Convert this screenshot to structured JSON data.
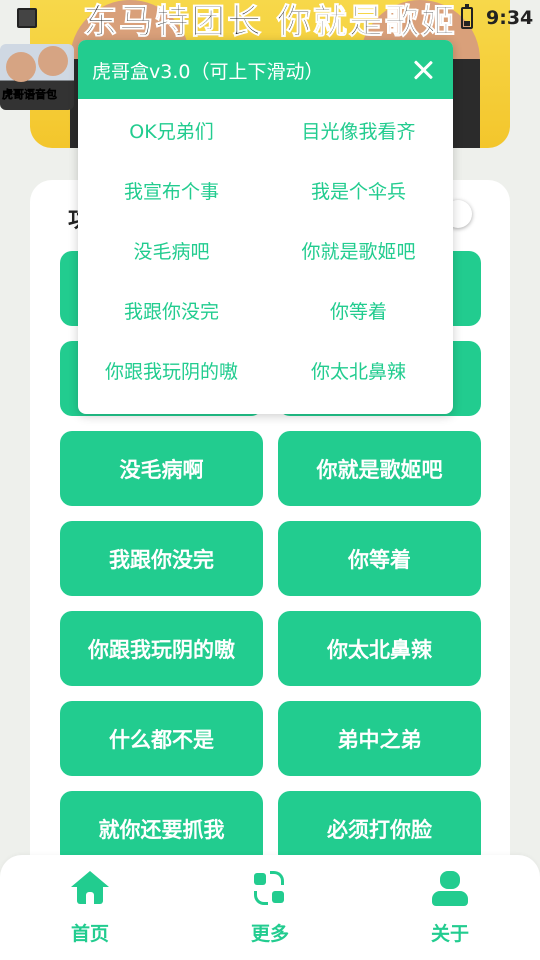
{
  "status_bar": {
    "time": "9:34"
  },
  "banner": {
    "text": "东马特团长 你就是歌姬"
  },
  "app_logo": {
    "text": "虎哥语音包"
  },
  "main": {
    "section_title": "功",
    "buttons": [
      {
        "label": "没毛病啊"
      },
      {
        "label": "你就是歌姬吧"
      },
      {
        "label": "我跟你没完"
      },
      {
        "label": "你等着"
      },
      {
        "label": "你跟我玩阴的嗷"
      },
      {
        "label": "你太北鼻辣"
      },
      {
        "label": "什么都不是"
      },
      {
        "label": "弟中之弟"
      },
      {
        "label": "就你还要抓我"
      },
      {
        "label": "必须打你脸"
      }
    ]
  },
  "dialog": {
    "title": "虎哥盒v3.0（可上下滑动）",
    "items": [
      {
        "label": "OK兄弟们"
      },
      {
        "label": "目光像我看齐"
      },
      {
        "label": "我宣布个事"
      },
      {
        "label": "我是个伞兵"
      },
      {
        "label": "没毛病吧"
      },
      {
        "label": "你就是歌姬吧"
      },
      {
        "label": "我跟你没完"
      },
      {
        "label": "你等着"
      },
      {
        "label": "你跟我玩阴的嗷"
      },
      {
        "label": "你太北鼻辣"
      }
    ]
  },
  "bottom_nav": {
    "items": [
      {
        "label": "首页",
        "icon": "home-icon"
      },
      {
        "label": "更多",
        "icon": "swap-icon"
      },
      {
        "label": "关于",
        "icon": "user-icon"
      }
    ]
  },
  "colors": {
    "accent": "#22cc8f",
    "background": "#eef0ec"
  }
}
